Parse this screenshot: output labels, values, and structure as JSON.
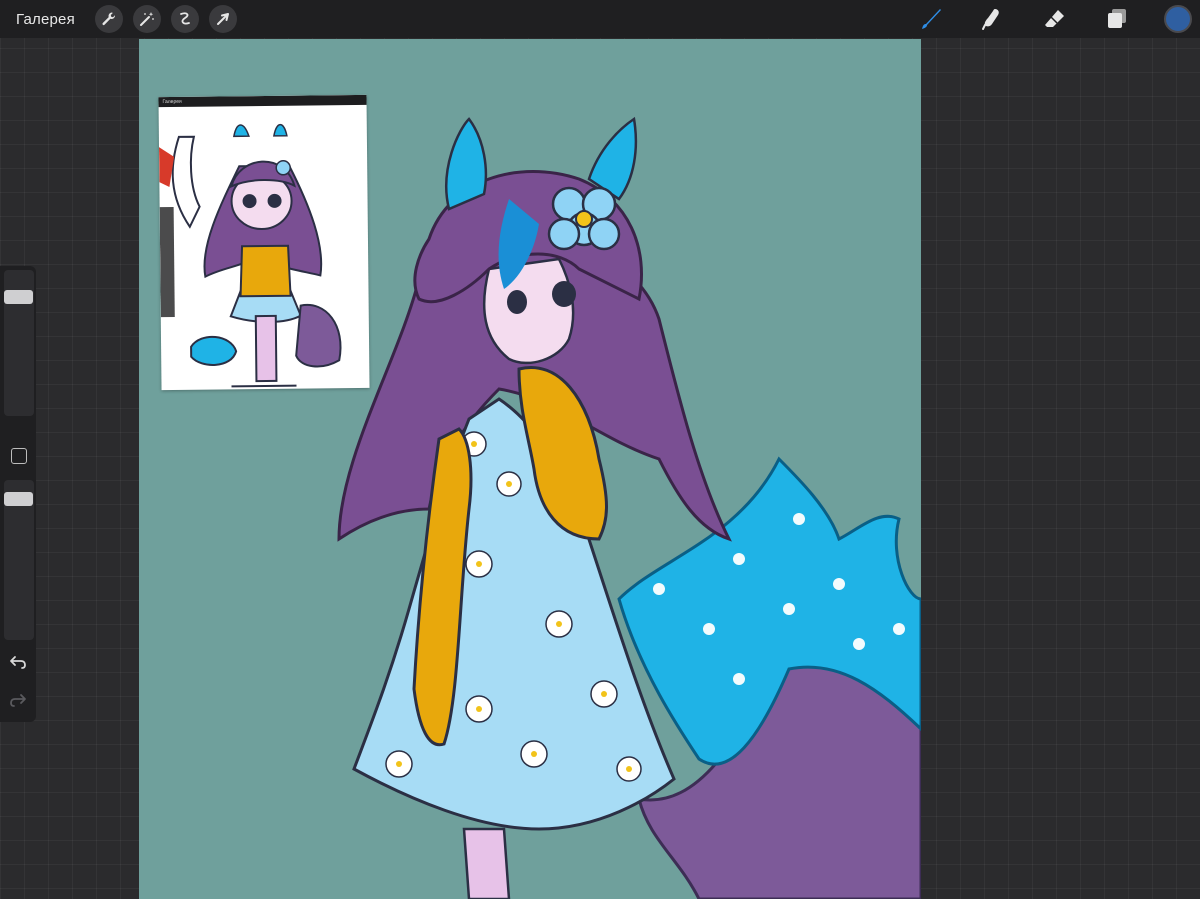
{
  "topbar": {
    "gallery_label": "Галерея",
    "left_tools": [
      "wrench-icon",
      "magic-wand-icon",
      "selection-icon",
      "transform-arrow-icon"
    ],
    "right_tools": [
      "brush-icon",
      "smudge-icon",
      "eraser-icon",
      "layers-icon"
    ],
    "current_color": "#2f5fa1"
  },
  "reference": {
    "toolbar_text": "Галерея"
  },
  "sidebar": {
    "controls": [
      "brush-size-slider",
      "modify-button",
      "brush-opacity-slider",
      "undo-icon",
      "redo-icon"
    ]
  },
  "colors": {
    "canvas_bg": "#6fa09c",
    "hair": "#7a4f93",
    "dress": "#a7dcf5",
    "sleeves": "#e8a80c",
    "tail_blue": "#1fb3e6",
    "tail_purple": "#7d5a99"
  }
}
